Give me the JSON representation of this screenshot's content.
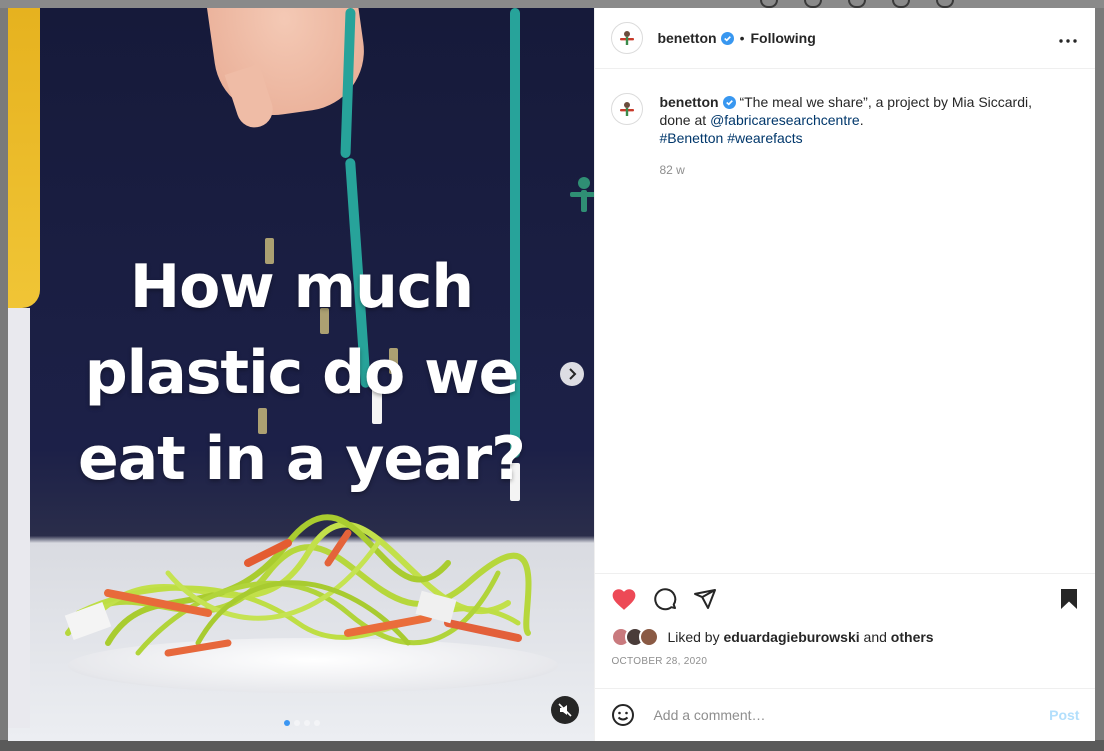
{
  "post": {
    "username": "benetton",
    "separator": "•",
    "follow_status": "Following",
    "more_icon": "more-horizontal-icon"
  },
  "media": {
    "headline": [
      "How much",
      "plastic do we",
      "eat in a year?"
    ],
    "slide_count": 4,
    "active_slide": 1
  },
  "caption": {
    "username": "benetton",
    "text_prefix": "“The meal we share”, a project by Mia Siccardi, done at ",
    "mention": "@fabricaresearchcentre",
    "text_suffix": ".",
    "hashtag1": "#Benetton",
    "hashtag2": "#wearefacts",
    "age": "82 w"
  },
  "engagement": {
    "liked_prefix": "Liked by",
    "liked_user": "eduardagieburowski",
    "and_label": "and",
    "others_label": "others",
    "date": "OCTOBER 28, 2020"
  },
  "comment": {
    "placeholder": "Add a comment…",
    "post_label": "Post"
  },
  "colors": {
    "heart": "#ed4956",
    "verified": "#3897f0",
    "link": "#00376b",
    "post_disabled": "#b2dffc"
  }
}
